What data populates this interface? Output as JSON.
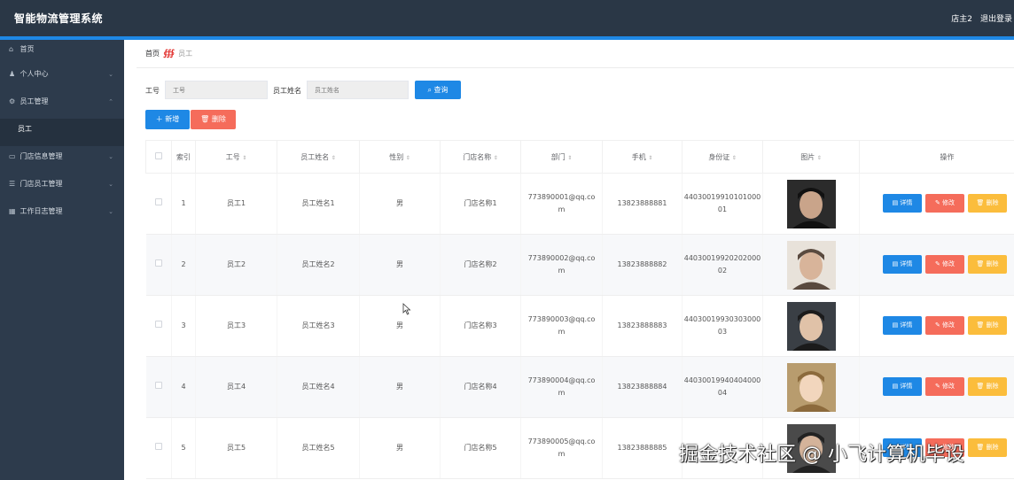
{
  "header": {
    "title": "智能物流管理系统",
    "user": "店主2",
    "logout": "退出登录"
  },
  "sidebar": {
    "items": [
      {
        "label": "首页",
        "icon": "home-icon"
      },
      {
        "label": "个人中心",
        "icon": "user-icon"
      },
      {
        "label": "员工管理",
        "icon": "settings-icon"
      },
      {
        "label": "员工",
        "icon": ""
      },
      {
        "label": "门店信息管理",
        "icon": "store-icon"
      },
      {
        "label": "门店员工管理",
        "icon": "list-icon"
      },
      {
        "label": "工作日志管理",
        "icon": "chart-icon"
      }
    ]
  },
  "breadcrumb": {
    "home": "首页",
    "current": "员工"
  },
  "search": {
    "label1": "工号",
    "placeholder1": "工号",
    "label2": "员工姓名",
    "placeholder2": "员工姓名",
    "query_label": "查询"
  },
  "actions": {
    "add_label": "新增",
    "delete_label": "删除"
  },
  "table": {
    "headers": [
      "索引",
      "工号",
      "员工姓名",
      "性别",
      "门店名称",
      "部门",
      "手机",
      "身份证",
      "图片",
      "操作"
    ],
    "op_labels": {
      "detail": "详情",
      "edit": "修改",
      "delete": "删除"
    },
    "rows": [
      {
        "index": "1",
        "id": "员工1",
        "name": "员工姓名1",
        "gender": "男",
        "store": "门店名称1",
        "dept_l1": "773890001@qq.co",
        "dept_l2": "m",
        "phone": "13823888881",
        "idcard_l1": "44030019910101000",
        "idcard_l2": "01"
      },
      {
        "index": "2",
        "id": "员工2",
        "name": "员工姓名2",
        "gender": "男",
        "store": "门店名称2",
        "dept_l1": "773890002@qq.co",
        "dept_l2": "m",
        "phone": "13823888882",
        "idcard_l1": "44030019920202000",
        "idcard_l2": "02"
      },
      {
        "index": "3",
        "id": "员工3",
        "name": "员工姓名3",
        "gender": "男",
        "store": "门店名称3",
        "dept_l1": "773890003@qq.co",
        "dept_l2": "m",
        "phone": "13823888883",
        "idcard_l1": "44030019930303000",
        "idcard_l2": "03"
      },
      {
        "index": "4",
        "id": "员工4",
        "name": "员工姓名4",
        "gender": "男",
        "store": "门店名称4",
        "dept_l1": "773890004@qq.co",
        "dept_l2": "m",
        "phone": "13823888884",
        "idcard_l1": "44030019940404000",
        "idcard_l2": "04"
      },
      {
        "index": "5",
        "id": "员工5",
        "name": "员工姓名5",
        "gender": "男",
        "store": "门店名称5",
        "dept_l1": "773890005@qq.co",
        "dept_l2": "m",
        "phone": "13823888885",
        "idcard_l1": "",
        "idcard_l2": ""
      }
    ]
  },
  "watermark": "掘金技术社区 @ 小飞计算机毕设",
  "colors": {
    "topbar": "#2a3746",
    "sidebar": "#2d3b4c",
    "accent": "#1e88e5",
    "danger": "#f56c5b",
    "warning": "#fbbd3c"
  }
}
